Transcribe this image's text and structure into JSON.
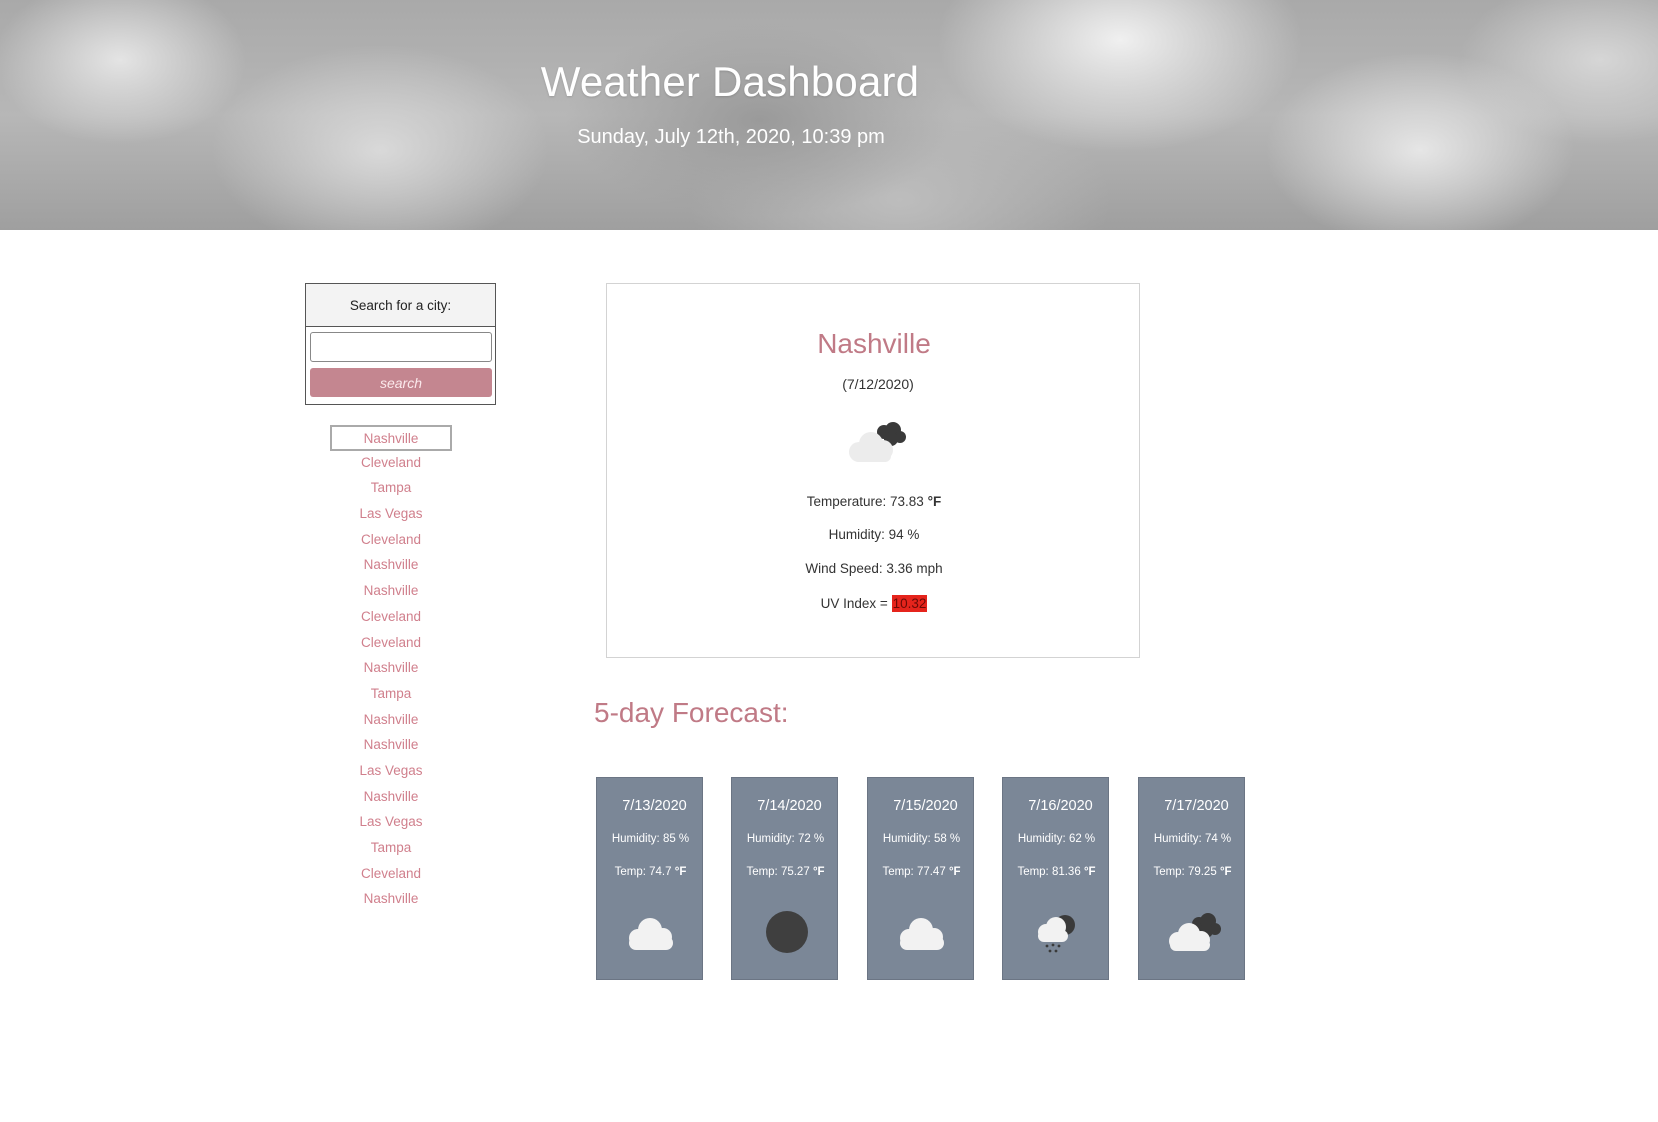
{
  "header": {
    "title": "Weather Dashboard",
    "datetime": "Sunday, July 12th, 2020, 10:39 pm"
  },
  "search": {
    "header_label": "Search for a city:",
    "input_value": "",
    "button_label": "search"
  },
  "history": [
    "Nashville",
    "Cleveland",
    "Tampa",
    "Las Vegas",
    "Cleveland",
    "Nashville",
    "Nashville",
    "Cleveland",
    "Cleveland",
    "Nashville",
    "Tampa",
    "Nashville",
    "Nashville",
    "Las Vegas",
    "Nashville",
    "Las Vegas",
    "Tampa",
    "Cleveland",
    "Nashville"
  ],
  "current": {
    "city": "Nashville",
    "date": "(7/12/2020)",
    "icon": "partly-cloudy-night-icon",
    "temperature_label": "Temperature: 73.83",
    "temperature_unit": "°F",
    "humidity": "Humidity: 94 %",
    "wind": "Wind Speed: 3.36 mph",
    "uv_label": "UV Index =",
    "uv_value": "10.32",
    "uv_color": "#e5241c"
  },
  "forecast": {
    "title": "5-day Forecast:",
    "days": [
      {
        "date": "7/13/2020",
        "humidity": "Humidity: 85 %",
        "temp": "Temp: 74.7",
        "unit": "°F",
        "icon": "cloud-icon"
      },
      {
        "date": "7/14/2020",
        "humidity": "Humidity: 72 %",
        "temp": "Temp: 75.27",
        "unit": "°F",
        "icon": "moon-icon"
      },
      {
        "date": "7/15/2020",
        "humidity": "Humidity: 58 %",
        "temp": "Temp: 77.47",
        "unit": "°F",
        "icon": "cloud-icon"
      },
      {
        "date": "7/16/2020",
        "humidity": "Humidity: 62 %",
        "temp": "Temp: 81.36",
        "unit": "°F",
        "icon": "rain-night-icon"
      },
      {
        "date": "7/17/2020",
        "humidity": "Humidity: 74 %",
        "temp": "Temp: 79.25",
        "unit": "°F",
        "icon": "partly-cloudy-night-icon"
      }
    ]
  },
  "colors": {
    "accent": "#c07a86",
    "button": "#c48690",
    "card": "#7b8797",
    "uv_high": "#e5241c"
  }
}
